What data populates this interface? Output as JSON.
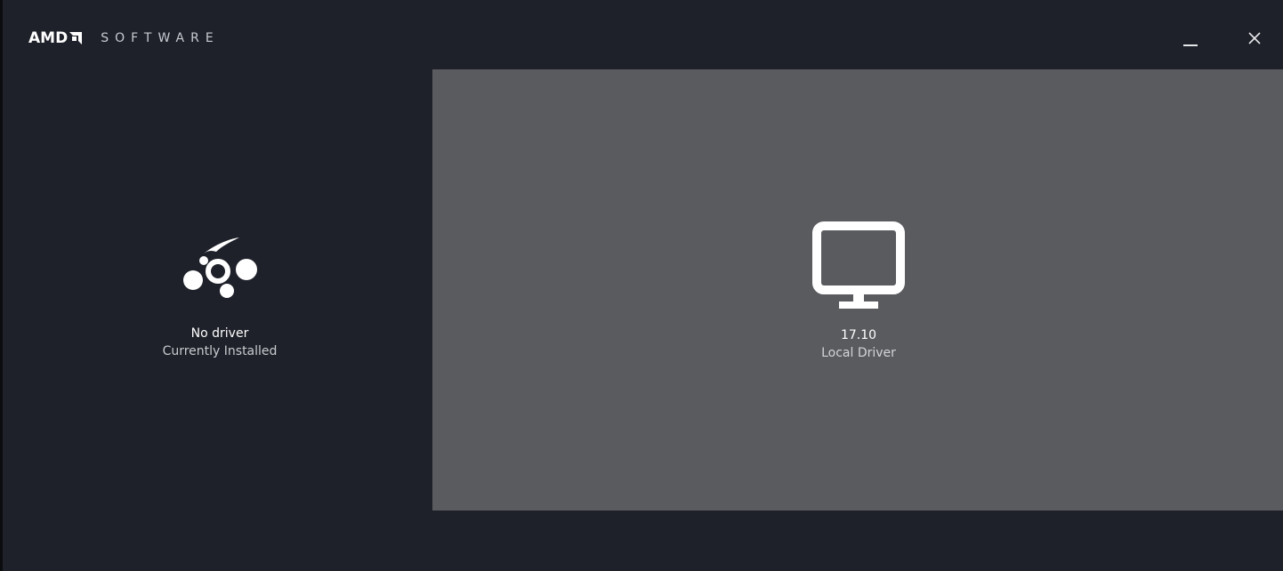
{
  "header": {
    "brand": "AMD",
    "product": "SOFTWARE",
    "window_controls": {
      "minimize_icon": "minimize-icon",
      "close_icon": "close-icon"
    }
  },
  "installed": {
    "icon": "no-driver-icon",
    "title": "No driver",
    "subtitle": "Currently Installed"
  },
  "local": {
    "icon": "monitor-icon",
    "title": "17.10",
    "subtitle": "Local Driver"
  },
  "colors": {
    "background": "#1e2129",
    "panel": "#5a5b5f",
    "text": "#ffffff"
  }
}
